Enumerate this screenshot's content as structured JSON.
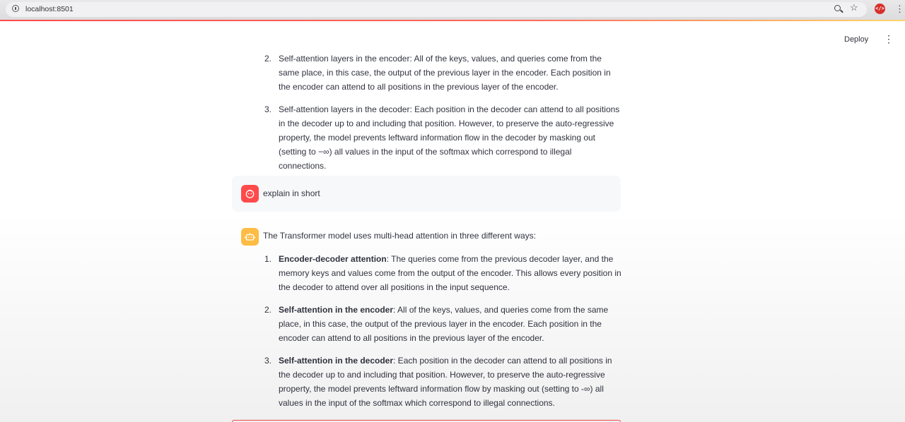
{
  "browser": {
    "url": "localhost:8501"
  },
  "header": {
    "deploy_label": "Deploy"
  },
  "previous_list": [
    {
      "num": "2.",
      "text": "Self-attention layers in the encoder: All of the keys, values, and queries come from the same place, in this case, the output of the previous layer in the encoder. Each position in the encoder can attend to all positions in the previous layer of the encoder."
    },
    {
      "num": "3.",
      "text": "Self-attention layers in the decoder: Each position in the decoder can attend to all positions in the decoder up to and including that position. However, to preserve the auto-regressive property, the model prevents leftward information flow in the decoder by masking out (setting to −∞) all values in the input of the softmax which correspond to illegal connections."
    }
  ],
  "user_message": {
    "text": "explain in short"
  },
  "assistant_message": {
    "intro": "The Transformer model uses multi-head attention in three different ways:",
    "items": [
      {
        "num": "1.",
        "bold": "Encoder-decoder attention",
        "text": ": The queries come from the previous decoder layer, and the memory keys and values come from the output of the encoder. This allows every position in the decoder to attend over all positions in the input sequence."
      },
      {
        "num": "2.",
        "bold": "Self-attention in the encoder",
        "text": ": All of the keys, values, and queries come from the same place, in this case, the output of the previous layer in the encoder. Each position in the encoder can attend to all positions in the previous layer of the encoder."
      },
      {
        "num": "3.",
        "bold": "Self-attention in the decoder",
        "text": ": Each position in the decoder can attend to all positions in the decoder up to and including that position. However, to preserve the auto-regressive property, the model prevents leftward information flow by masking out (setting to -∞) all values in the input of the softmax which correspond to illegal connections."
      }
    ]
  },
  "icons": {
    "info": "info-icon",
    "zoom": "zoom-icon",
    "star": "star-icon",
    "extension": "extension-icon",
    "menu": "vertical-dots-icon",
    "user_avatar": "user-face-icon",
    "bot_avatar": "robot-icon"
  },
  "colors": {
    "accent": "#ff4b4b",
    "user_avatar": "#ff4b4b",
    "bot_avatar": "#ffbd45",
    "text": "#31333f"
  }
}
